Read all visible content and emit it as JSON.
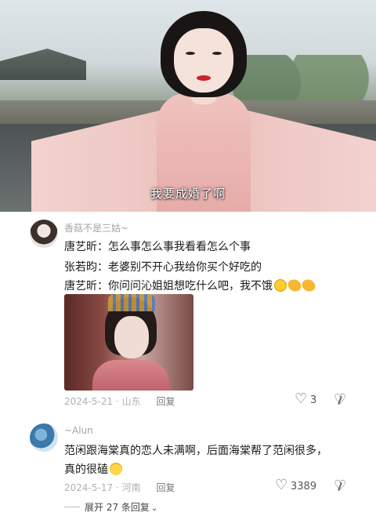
{
  "video": {
    "subtitle": "我要成婚了啊"
  },
  "comments": [
    {
      "username": "香菇不是三姑~",
      "lines": [
        "唐艺昕：怎么事怎么事我看看怎么个事",
        "张若昀：老婆别不开心我给你买个好吃的",
        "唐艺昕：你问问沁姐姐想吃什么吧，我不饿"
      ],
      "emojis": [
        "smile-emoji",
        "hand-emoji",
        "hand-emoji"
      ],
      "date": "2024-5-21",
      "location": "山东",
      "reply_label": "回复",
      "likes": "3"
    },
    {
      "username": "~Alun",
      "lines": [
        "范闲跟海棠真的恋人未满啊，后面海棠帮了范闲很多，",
        "真的很磕"
      ],
      "emojis": [
        "blush-emoji"
      ],
      "date": "2024-5-17",
      "location": "河南",
      "reply_label": "回复",
      "likes": "3389"
    }
  ],
  "expand_replies": {
    "label": "展开 27 条回复"
  },
  "colors": {
    "meta_gray": "#b0b0b0",
    "username_gray": "#a3a3a3",
    "text": "#1a1a1a"
  }
}
